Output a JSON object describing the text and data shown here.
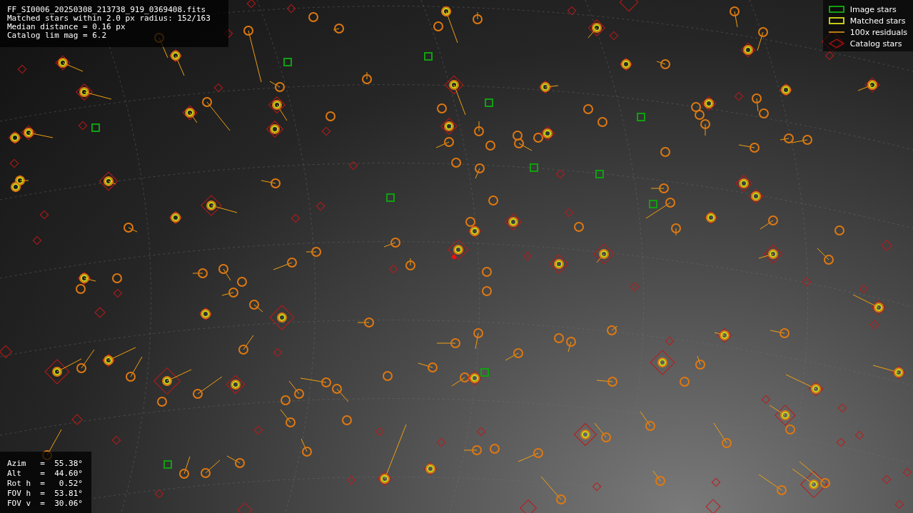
{
  "info": {
    "lines": [
      "FF_SI0006_20250308_213738_919_0369408.fits",
      "Matched stars within 2.0 px radius: 152/163",
      "Median distance = 0.16 px",
      "Catalog lim mag = 6.2"
    ]
  },
  "legend": [
    {
      "kind": "image",
      "label": "Image stars"
    },
    {
      "kind": "matched",
      "label": "Matched stars"
    },
    {
      "kind": "residual",
      "label": "100x residuals"
    },
    {
      "kind": "catalog",
      "label": "Catalog stars"
    }
  ],
  "pointing": {
    "lines": [
      "Azim   =  55.38°",
      "Alt    =  44.60°",
      "Rot h  =   0.52°",
      "FOV h  =  53.81°",
      "FOV v  =  30.06°"
    ]
  }
}
